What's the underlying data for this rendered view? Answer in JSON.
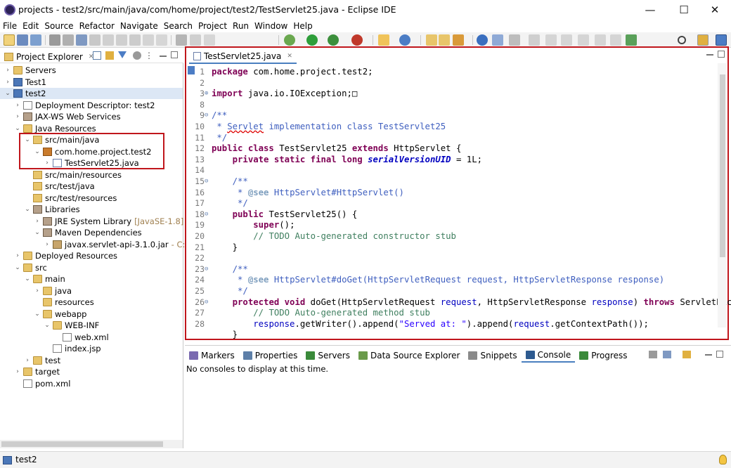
{
  "window": {
    "title": "projects - test2/src/main/java/com/home/project/test2/TestServlet25.java - Eclipse IDE",
    "minimize": "—",
    "maximize": "☐",
    "close": "✕"
  },
  "menu": [
    "File",
    "Edit",
    "Source",
    "Refactor",
    "Navigate",
    "Search",
    "Project",
    "Run",
    "Window",
    "Help"
  ],
  "explorer": {
    "title": "Project Explorer",
    "close": "✕",
    "tree": [
      {
        "label": "Servers",
        "indent": 0,
        "twisty": "›",
        "icon": "folder"
      },
      {
        "label": "Test1",
        "indent": 0,
        "twisty": "›",
        "icon": "proj"
      },
      {
        "label": "test2",
        "indent": 0,
        "twisty": "⌄",
        "icon": "proj",
        "selected": true
      },
      {
        "label": "Deployment Descriptor: test2",
        "indent": 1,
        "twisty": "›",
        "icon": "xmlf"
      },
      {
        "label": "JAX-WS Web Services",
        "indent": 1,
        "twisty": "›",
        "icon": "lib"
      },
      {
        "label": "Java Resources",
        "indent": 1,
        "twisty": "⌄",
        "icon": "folder"
      },
      {
        "label": "src/main/java",
        "indent": 2,
        "twisty": "⌄",
        "icon": "srcf"
      },
      {
        "label": "com.home.project.test2",
        "indent": 3,
        "twisty": "⌄",
        "icon": "pkg"
      },
      {
        "label": "TestServlet25.java",
        "indent": 4,
        "twisty": "›",
        "icon": "javaf"
      },
      {
        "label": "src/main/resources",
        "indent": 2,
        "twisty": "",
        "icon": "srcf"
      },
      {
        "label": "src/test/java",
        "indent": 2,
        "twisty": "",
        "icon": "srcf"
      },
      {
        "label": "src/test/resources",
        "indent": 2,
        "twisty": "",
        "icon": "srcf"
      },
      {
        "label": "Libraries",
        "indent": 2,
        "twisty": "⌄",
        "icon": "lib"
      },
      {
        "label": "JRE System Library",
        "decor": "[JavaSE-1.8]",
        "indent": 3,
        "twisty": "›",
        "icon": "lib"
      },
      {
        "label": "Maven Dependencies",
        "indent": 3,
        "twisty": "⌄",
        "icon": "lib"
      },
      {
        "label": "javax.servlet-api-3.1.0.jar",
        "decor": "- C:\\Use",
        "indent": 4,
        "twisty": "›",
        "icon": "jar"
      },
      {
        "label": "Deployed Resources",
        "indent": 1,
        "twisty": "›",
        "icon": "folder"
      },
      {
        "label": "src",
        "indent": 1,
        "twisty": "⌄",
        "icon": "folder"
      },
      {
        "label": "main",
        "indent": 2,
        "twisty": "⌄",
        "icon": "folder"
      },
      {
        "label": "java",
        "indent": 3,
        "twisty": "›",
        "icon": "folder"
      },
      {
        "label": "resources",
        "indent": 3,
        "twisty": "",
        "icon": "folder"
      },
      {
        "label": "webapp",
        "indent": 3,
        "twisty": "⌄",
        "icon": "folder"
      },
      {
        "label": "WEB-INF",
        "indent": 4,
        "twisty": "⌄",
        "icon": "folder"
      },
      {
        "label": "web.xml",
        "indent": 5,
        "twisty": "",
        "icon": "xmlf"
      },
      {
        "label": "index.jsp",
        "indent": 4,
        "twisty": "",
        "icon": "xmlf"
      },
      {
        "label": "test",
        "indent": 2,
        "twisty": "›",
        "icon": "folder"
      },
      {
        "label": "target",
        "indent": 1,
        "twisty": "›",
        "icon": "folder"
      },
      {
        "label": "pom.xml",
        "indent": 1,
        "twisty": "",
        "icon": "xmlf"
      }
    ]
  },
  "editor": {
    "tab_label": "TestServlet25.java",
    "tab_close": "✕",
    "lines": [
      {
        "n": "1",
        "fold": "",
        "html": "<span class='kw'>package</span> com.home.project.test2;"
      },
      {
        "n": "2",
        "fold": "",
        "html": ""
      },
      {
        "n": "3",
        "fold": "⊕",
        "html": "<span class='kw'>import</span> java.io.IOException;□"
      },
      {
        "n": "8",
        "fold": "",
        "html": ""
      },
      {
        "n": "9",
        "fold": "⊖",
        "html": "<span class='jd'>/**</span>"
      },
      {
        "n": "10",
        "fold": "",
        "html": "<span class='jd'> * <u style='text-decoration-color:#d00;text-decoration-style:wavy'>Servlet</u> implementation class TestServlet25</span>"
      },
      {
        "n": "11",
        "fold": "",
        "html": "<span class='jd'> */</span>"
      },
      {
        "n": "12",
        "fold": "",
        "html": "<span class='kw'>public class</span> TestServlet25 <span class='kw'>extends</span> HttpServlet {"
      },
      {
        "n": "13",
        "fold": "",
        "html": "    <span class='kw'>private static final long</span> <span class='it'>serialVersionUID</span> = 1L;"
      },
      {
        "n": "14",
        "fold": "",
        "html": ""
      },
      {
        "n": "15",
        "fold": "⊖",
        "html": "    <span class='jd'>/**</span>"
      },
      {
        "n": "16",
        "fold": "",
        "html": "    <span class='jd'> * <span class='tag'>@see</span> HttpServlet#HttpServlet()</span>"
      },
      {
        "n": "17",
        "fold": "",
        "html": "    <span class='jd'> */</span>"
      },
      {
        "n": "18",
        "fold": "⊖",
        "html": "    <span class='kw'>public</span> TestServlet25() {"
      },
      {
        "n": "19",
        "fold": "",
        "html": "        <span class='kw'>super</span>();"
      },
      {
        "n": "20",
        "fold": "",
        "html": "        <span class='cm'>// TODO Auto-generated constructor stub</span>"
      },
      {
        "n": "21",
        "fold": "",
        "html": "    }"
      },
      {
        "n": "22",
        "fold": "",
        "html": ""
      },
      {
        "n": "23",
        "fold": "⊖",
        "html": "    <span class='jd'>/**</span>"
      },
      {
        "n": "24",
        "fold": "",
        "html": "    <span class='jd'> * <span class='tag'>@see</span> HttpServlet#doGet(HttpServletRequest request, HttpServletResponse response)</span>"
      },
      {
        "n": "25",
        "fold": "",
        "html": "    <span class='jd'> */</span>"
      },
      {
        "n": "26",
        "fold": "⊖",
        "html": "    <span class='kw'>protected void</span> doGet(HttpServletRequest <span class='fd'>request</span>, HttpServletResponse <span class='fd'>response</span>) <span class='kw'>throws</span> ServletExcepti"
      },
      {
        "n": "27",
        "fold": "",
        "html": "        <span class='cm'>// TODO Auto-generated method stub</span>"
      },
      {
        "n": "28",
        "fold": "",
        "html": "        <span class='fd'>response</span>.getWriter().append(<span class='st'>\"Served at: \"</span>).append(<span class='fd'>request</span>.getContextPath());"
      },
      {
        "n": "",
        "fold": "",
        "html": "    }"
      }
    ]
  },
  "bottom": {
    "tabs": [
      {
        "label": "Markers",
        "color": "#7a6ab0"
      },
      {
        "label": "Properties",
        "color": "#5d7fa8"
      },
      {
        "label": "Servers",
        "color": "#3a8a3a"
      },
      {
        "label": "Data Source Explorer",
        "color": "#6a9a4a"
      },
      {
        "label": "Snippets",
        "color": "#8a8a8a"
      },
      {
        "label": "Console",
        "color": "#2d5a8f",
        "active": true
      },
      {
        "label": "Progress",
        "color": "#3a8a3a"
      }
    ],
    "console_message": "No consoles to display at this time."
  },
  "status": {
    "text": "test2"
  }
}
